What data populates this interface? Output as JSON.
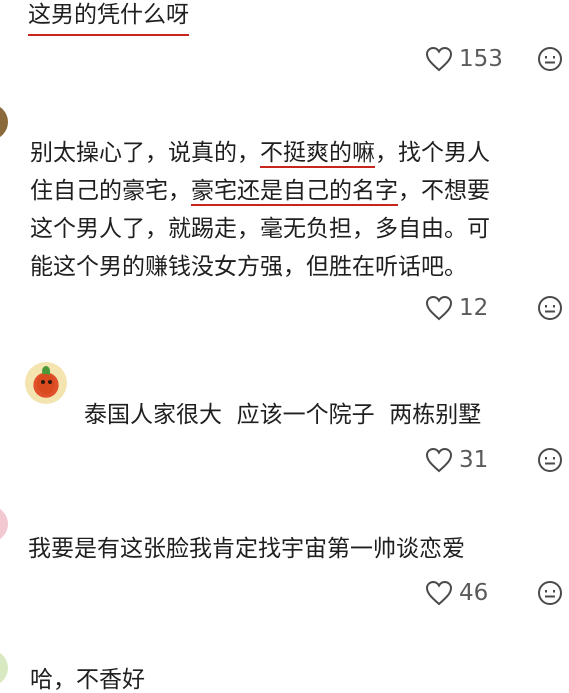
{
  "comments": [
    {
      "text": "这男的凭什么呀",
      "likes": "153"
    },
    {
      "lines": [
        [
          "别太操心了，说真的，",
          "不挺爽的嘛",
          "，找个男人"
        ],
        [
          "住自己的豪宅，",
          "豪宅还是自己的名字",
          "，不想要"
        ],
        [
          "这个男人了，就踢走，毫无负担，多自由。可"
        ],
        [
          "能这个男的赚钱没女方强，但胜在听话吧。"
        ]
      ],
      "likes": "12"
    },
    {
      "text": "泰国人家很大  应该一个院子  两栋别墅",
      "likes": "31"
    },
    {
      "text": "我要是有这张脸我肯定找宇宙第一帅谈恋爱",
      "likes": "46"
    },
    {
      "text": "哈，不香好"
    }
  ],
  "icons": {
    "like": "heart-outline-icon",
    "emoji": "smiley-face-icon"
  },
  "colors": {
    "underline": "#c8261c",
    "count": "#5a5a5a"
  }
}
